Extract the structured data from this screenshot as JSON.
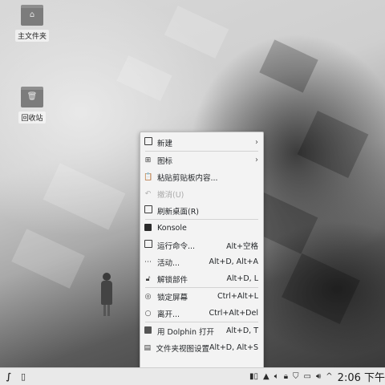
{
  "desktop": {
    "icons": [
      {
        "label": "主文件夹",
        "glyph": "⌂"
      },
      {
        "label": "回收站",
        "glyph": "🗑"
      }
    ]
  },
  "context_menu": {
    "items": [
      {
        "icon": "new-document-icon",
        "label": "新建",
        "shortcut": "",
        "submenu": true,
        "disabled": false
      },
      {
        "icon": "icons-view-icon",
        "label": "图标",
        "shortcut": "",
        "submenu": true,
        "disabled": false
      },
      {
        "icon": "clipboard-icon",
        "label": "粘贴剪贴板内容...",
        "shortcut": "",
        "submenu": false,
        "disabled": false
      },
      {
        "icon": "undo-icon",
        "label": "撤消(U)",
        "shortcut": "",
        "submenu": false,
        "disabled": true
      },
      {
        "icon": "refresh-icon",
        "label": "刷新桌面(R)",
        "shortcut": "",
        "submenu": false,
        "disabled": false
      },
      {
        "icon": "konsole-icon",
        "label": "Konsole",
        "shortcut": "",
        "submenu": false,
        "disabled": false
      },
      {
        "icon": "run-command-icon",
        "label": "运行命令...",
        "shortcut": "Alt+空格",
        "submenu": false,
        "disabled": false
      },
      {
        "icon": "activities-icon",
        "label": "活动...",
        "shortcut": "Alt+D, Alt+A",
        "submenu": false,
        "disabled": false
      },
      {
        "icon": "unlock-icon",
        "label": "解锁部件",
        "shortcut": "Alt+D, L",
        "submenu": false,
        "disabled": false
      },
      {
        "icon": "lock-screen-icon",
        "label": "锁定屏幕",
        "shortcut": "Ctrl+Alt+L",
        "submenu": false,
        "disabled": false
      },
      {
        "icon": "leave-icon",
        "label": "离开...",
        "shortcut": "Ctrl+Alt+Del",
        "submenu": false,
        "disabled": false
      },
      {
        "icon": "dolphin-icon",
        "label": "用 Dolphin 打开",
        "shortcut": "Alt+D, T",
        "submenu": false,
        "disabled": false
      },
      {
        "icon": "folder-settings-icon",
        "label": "文件夹视图设置",
        "shortcut": "Alt+D, Alt+S",
        "submenu": false,
        "disabled": false
      }
    ]
  },
  "taskbar": {
    "clock": "2:06 下午"
  }
}
